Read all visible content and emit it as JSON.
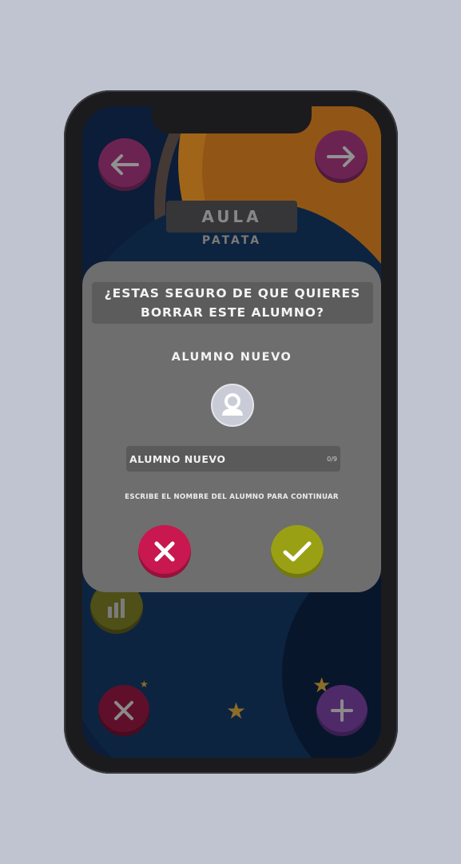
{
  "header": {
    "title": "AULA",
    "subtitle": "PATATA"
  },
  "dialog": {
    "question": "¿ESTAS SEGURO DE QUE QUIERES\nBORRAR ESTE ALUMNO?",
    "student_name": "ALUMNO NUEVO",
    "input_value": "ALUMNO NUEVO",
    "char_count": "0/9",
    "instruction": "ESCRIBE EL NOMBRE DEL ALUMNO PARA CONTINUAR"
  },
  "icons": {
    "back": "arrow-left-icon",
    "forward": "arrow-right-icon",
    "stats": "bar-chart-icon",
    "delete": "close-icon",
    "add": "plus-icon",
    "avatar": "user-icon",
    "cancel": "close-icon",
    "confirm": "check-icon"
  },
  "colors": {
    "background": "#c0c4d1",
    "magenta": "#8e2d68",
    "crimson": "#c8184f",
    "olive": "#9aa014",
    "purple": "#6a3a8c",
    "orange": "#b8741e",
    "modal": "#6e6e6e"
  }
}
